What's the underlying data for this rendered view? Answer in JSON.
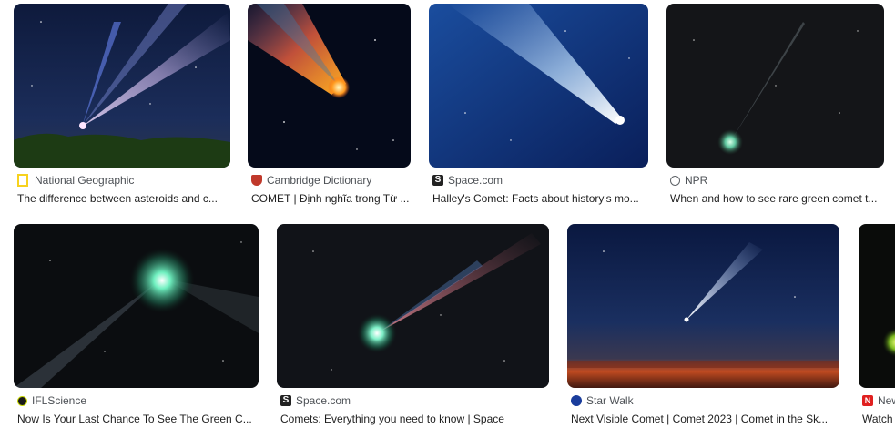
{
  "results": [
    {
      "source": "National Geographic",
      "title": "The difference between asteroids and c...",
      "favicon": "natgeo-icon",
      "favicon_color": "#f7d21e"
    },
    {
      "source": "Cambridge Dictionary",
      "title": "COMET | Định nghĩa trong Từ ...",
      "favicon": "cambridge-shield-icon",
      "favicon_color": "#c0392b"
    },
    {
      "source": "Space.com",
      "title": "Halley's Comet: Facts about history's mo...",
      "favicon": "space-com-icon",
      "favicon_color": "#222222"
    },
    {
      "source": "NPR",
      "title": "When and how to see rare green comet t...",
      "favicon": "npr-globe-icon",
      "favicon_color": "#5f6368"
    },
    {
      "source": "IFLScience",
      "title": "Now Is Your Last Chance To See The Green C...",
      "favicon": "iflscience-icon",
      "favicon_color": "#c5d400"
    },
    {
      "source": "Space.com",
      "title": "Comets: Everything you need to know | Space",
      "favicon": "space-com-icon",
      "favicon_color": "#222222"
    },
    {
      "source": "Star Walk",
      "title": "Next Visible Comet | Comet 2023 | Comet in the Sk...",
      "favicon": "star-walk-icon",
      "favicon_color": "#1a3d9c"
    },
    {
      "source": "New",
      "title": "Watch",
      "favicon": "newsweek-icon",
      "favicon_color": "#e02020"
    }
  ]
}
